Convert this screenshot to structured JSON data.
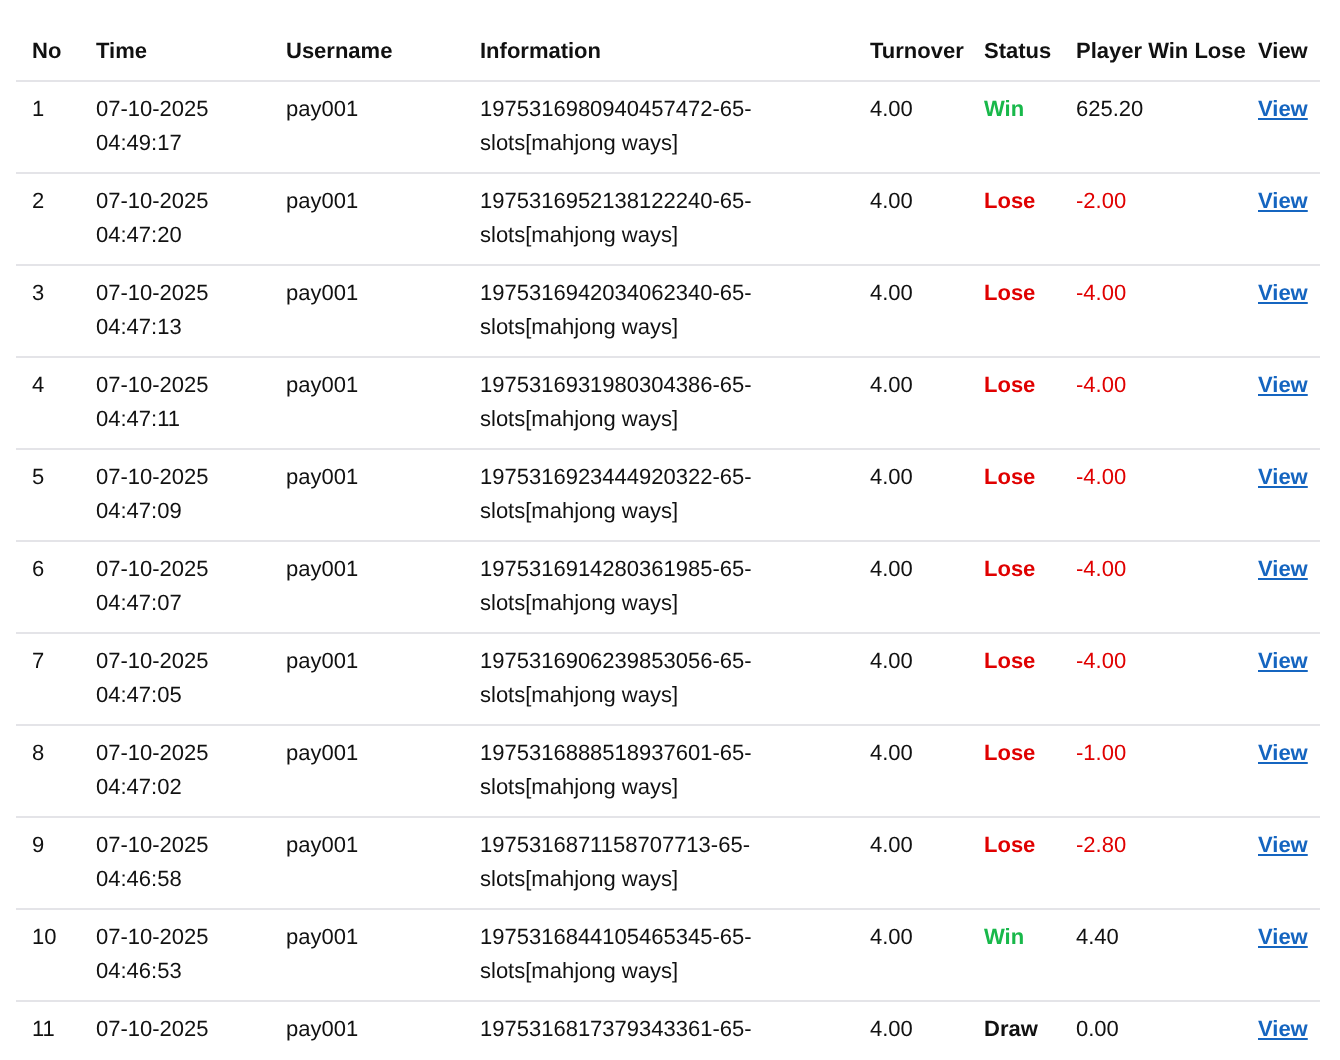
{
  "columns": [
    "No",
    "Time",
    "Username",
    "Information",
    "Turnover",
    "Status",
    "Player Win Lose",
    "View"
  ],
  "rows": [
    {
      "no": "1",
      "time": "07-10-2025 04:49:17",
      "username": "pay001",
      "information": "1975316980940457472-65-slots[mahjong ways]",
      "turnover": "4.00",
      "status": {
        "kind": "win",
        "label": "Win"
      },
      "win_lose": "625.20",
      "view": "View"
    },
    {
      "no": "2",
      "time": "07-10-2025 04:47:20",
      "username": "pay001",
      "information": "1975316952138122240-65-slots[mahjong ways]",
      "turnover": "4.00",
      "status": {
        "kind": "lose",
        "label": "Lose"
      },
      "win_lose": "-2.00",
      "view": "View"
    },
    {
      "no": "3",
      "time": "07-10-2025 04:47:13",
      "username": "pay001",
      "information": "1975316942034062340-65-slots[mahjong ways]",
      "turnover": "4.00",
      "status": {
        "kind": "lose",
        "label": "Lose"
      },
      "win_lose": "-4.00",
      "view": "View"
    },
    {
      "no": "4",
      "time": "07-10-2025 04:47:11",
      "username": "pay001",
      "information": "1975316931980304386-65-slots[mahjong ways]",
      "turnover": "4.00",
      "status": {
        "kind": "lose",
        "label": "Lose"
      },
      "win_lose": "-4.00",
      "view": "View"
    },
    {
      "no": "5",
      "time": "07-10-2025 04:47:09",
      "username": "pay001",
      "information": "1975316923444920322-65-slots[mahjong ways]",
      "turnover": "4.00",
      "status": {
        "kind": "lose",
        "label": "Lose"
      },
      "win_lose": "-4.00",
      "view": "View"
    },
    {
      "no": "6",
      "time": "07-10-2025 04:47:07",
      "username": "pay001",
      "information": "1975316914280361985-65-slots[mahjong ways]",
      "turnover": "4.00",
      "status": {
        "kind": "lose",
        "label": "Lose"
      },
      "win_lose": "-4.00",
      "view": "View"
    },
    {
      "no": "7",
      "time": "07-10-2025 04:47:05",
      "username": "pay001",
      "information": "1975316906239853056-65-slots[mahjong ways]",
      "turnover": "4.00",
      "status": {
        "kind": "lose",
        "label": "Lose"
      },
      "win_lose": "-4.00",
      "view": "View"
    },
    {
      "no": "8",
      "time": "07-10-2025 04:47:02",
      "username": "pay001",
      "information": "1975316888518937601-65-slots[mahjong ways]",
      "turnover": "4.00",
      "status": {
        "kind": "lose",
        "label": "Lose"
      },
      "win_lose": "-1.00",
      "view": "View"
    },
    {
      "no": "9",
      "time": "07-10-2025 04:46:58",
      "username": "pay001",
      "information": "1975316871158707713-65-slots[mahjong ways]",
      "turnover": "4.00",
      "status": {
        "kind": "lose",
        "label": "Lose"
      },
      "win_lose": "-2.80",
      "view": "View"
    },
    {
      "no": "10",
      "time": "07-10-2025 04:46:53",
      "username": "pay001",
      "information": "1975316844105465345-65-slots[mahjong ways]",
      "turnover": "4.00",
      "status": {
        "kind": "win",
        "label": "Win"
      },
      "win_lose": "4.40",
      "view": "View"
    },
    {
      "no": "11",
      "time": "07-10-2025",
      "username": "pay001",
      "information": "1975316817379343361-65-",
      "turnover": "4.00",
      "status": {
        "kind": "draw",
        "label": "Draw"
      },
      "win_lose": "0.00",
      "view": "View"
    }
  ]
}
